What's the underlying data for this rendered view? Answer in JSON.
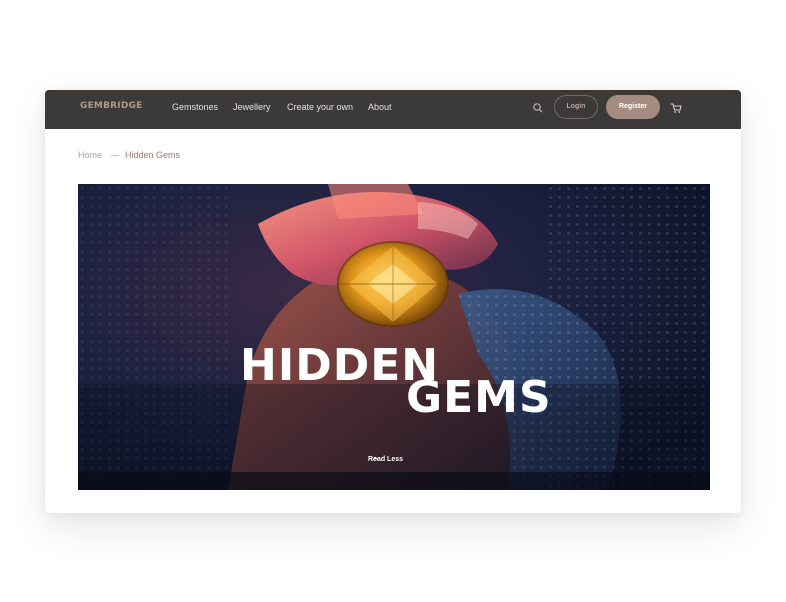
{
  "brand": {
    "logo": "GEMBRIDGE"
  },
  "nav": {
    "links": [
      {
        "label": "Gemstones"
      },
      {
        "label": "Jewellery"
      },
      {
        "label": "Create your own"
      },
      {
        "label": "About"
      }
    ],
    "login_label": "Login",
    "register_label": "Register",
    "search_icon": "search-icon",
    "cart_icon": "cart-icon"
  },
  "breadcrumb": {
    "home": "Home",
    "current": "Hidden Gems"
  },
  "hero": {
    "title_line1": "HIDDEN",
    "title_line2": "GEMS",
    "read_less": "Read Less"
  },
  "colors": {
    "navbar": "#3b3a39",
    "logo": "#b09a8c",
    "register": "#a48c81",
    "breadcrumb_current": "#9a7b6e"
  }
}
